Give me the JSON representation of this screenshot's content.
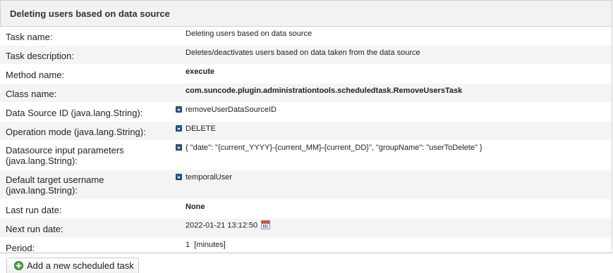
{
  "panel": {
    "title": "Deleting users based on data source"
  },
  "fields": {
    "task_name": {
      "label": "Task name:",
      "value": "Deleting users based on data source"
    },
    "task_description": {
      "label": "Task description:",
      "value": "Deletes/deactivates users based on data taken from the data source"
    },
    "method_name": {
      "label": "Method name:",
      "value": "execute"
    },
    "class_name": {
      "label": "Class name:",
      "value": "com.suncode.plugin.administrationtools.scheduledtask.RemoveUsersTask"
    },
    "data_source_id": {
      "label": "Data Source ID (java.lang.String):",
      "value": "removeUserDataSourceID"
    },
    "operation_mode": {
      "label": "Operation mode (java.lang.String):",
      "value": "DELETE"
    },
    "datasource_params": {
      "label_line1": "Datasource input parameters",
      "label_line2": "(java.lang.String):",
      "value": "{ \"date\": \"{current_YYYY}-{current_MM}-{current_DD}\", \"groupName\": \"userToDelete\" }"
    },
    "default_target_username": {
      "label_line1": "Default target username",
      "label_line2": "(java.lang.String):",
      "value": "temporalUser"
    },
    "last_run_date": {
      "label": "Last run date:",
      "value": "None"
    },
    "next_run_date": {
      "label": "Next run date:",
      "value": "2022-01-21 13:12:50"
    },
    "period": {
      "label": "Period:",
      "value": "1  [minutes]"
    }
  },
  "icons": {
    "parameter": "lock-icon",
    "calendar": "calendar-icon",
    "add": "add-circle-icon"
  },
  "colors": {
    "header_bg": "#f2f2f2",
    "row_alt_bg": "#f4f4f4",
    "add_icon": "#3d9a3d",
    "param_icon": "#2f5d8c"
  },
  "actions": {
    "add_task_label": "Add a new scheduled task"
  }
}
